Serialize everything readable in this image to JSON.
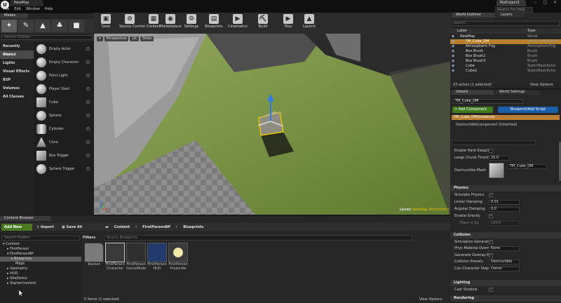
{
  "app": {
    "logo": "U",
    "doc_tab": "NewMap",
    "project_tab": "MyProject3",
    "search_help": "Search For Help",
    "menu": [
      "File",
      "Edit",
      "Window",
      "Help"
    ],
    "win": {
      "min": "–",
      "max": "□",
      "close": "✕"
    }
  },
  "modes": {
    "tab": "Modes",
    "icons": [
      {
        "name": "place-mode-icon",
        "glyph": "✦"
      },
      {
        "name": "paint-mode-icon",
        "glyph": "✎"
      },
      {
        "name": "landscape-mode-icon",
        "glyph": "▲"
      },
      {
        "name": "foliage-mode-icon",
        "glyph": "♣"
      },
      {
        "name": "geometry-mode-icon",
        "glyph": "■"
      }
    ],
    "search_placeholder": "Search Classes",
    "categories": [
      "Recently Placed",
      "Basic",
      "Lights",
      "Visual Effects",
      "BSP",
      "Volumes",
      "All Classes"
    ],
    "items": [
      {
        "label": "Empty Actor",
        "shape": "sphere"
      },
      {
        "label": "Empty Character",
        "shape": "sphere"
      },
      {
        "label": "Point Light",
        "shape": "sphere"
      },
      {
        "label": "Player Start",
        "shape": "sphere"
      },
      {
        "label": "Cube",
        "shape": "box"
      },
      {
        "label": "Sphere",
        "shape": "sphere"
      },
      {
        "label": "Cylinder",
        "shape": "cyl"
      },
      {
        "label": "Cone",
        "shape": "cone"
      },
      {
        "label": "Box Trigger",
        "shape": "box"
      },
      {
        "label": "Sphere Trigger",
        "shape": "sphere"
      }
    ]
  },
  "toolbar": {
    "buttons": [
      {
        "label": "Save",
        "icon": "save-icon",
        "glyph": "▣"
      },
      {
        "label": "Source Control",
        "icon": "source-control-icon",
        "glyph": "⊘"
      },
      {
        "label": "Content",
        "icon": "content-icon",
        "glyph": "▦"
      },
      {
        "label": "Marketplace",
        "icon": "marketplace-icon",
        "glyph": "◉"
      },
      {
        "label": "Settings",
        "icon": "settings-icon",
        "glyph": "⚙"
      },
      {
        "label": "Blueprints",
        "icon": "blueprints-icon",
        "glyph": "▤"
      },
      {
        "label": "Cinematics",
        "icon": "cinematics-icon",
        "glyph": "▶"
      },
      {
        "label": "Build",
        "icon": "build-icon",
        "glyph": "⛏"
      },
      {
        "label": "Play",
        "icon": "play-icon",
        "glyph": "▶"
      },
      {
        "label": "Launch",
        "icon": "launch-icon",
        "glyph": "▲"
      }
    ]
  },
  "viewport": {
    "perspective": "Perspective",
    "lit": "Lit",
    "show": "Show",
    "level_label": "Level:",
    "level_name": "NewMap (Persistent)"
  },
  "content_browser": {
    "tab": "Content Browser",
    "add_new": "Add New",
    "import": "Import",
    "save_all": "Save All",
    "crumbs": [
      "Content",
      "FirstPersonBP",
      "Blueprints"
    ],
    "search_folders": "Search Folders",
    "tree": [
      {
        "label": "▾ Content",
        "indent": 4
      },
      {
        "label": "▸ FirstPerson",
        "indent": 10
      },
      {
        "label": "▾ FirstPersonBP",
        "indent": 10
      },
      {
        "label": "▸ Blueprints",
        "indent": 16
      },
      {
        "label": "Maps",
        "indent": 22
      },
      {
        "label": "▸ Geometry",
        "indent": 10
      },
      {
        "label": "▸ HUD",
        "indent": 10
      },
      {
        "label": "▸ SiteDemo",
        "indent": 10
      },
      {
        "label": "▸ StarterContent",
        "indent": 10
      }
    ],
    "selected_tree_index": 3,
    "filters": "Filters",
    "search_placeholder": "Search Blueprints",
    "assets": [
      {
        "label": "Rocket",
        "kind": "folder"
      },
      {
        "label": "FirstPerson Character",
        "kind": "char"
      },
      {
        "label": "FirstPerson GameMode",
        "kind": "game"
      },
      {
        "label": "FirstPerson HUD",
        "kind": "hud"
      },
      {
        "label": "FirstPerson Projectile",
        "kind": "proj"
      }
    ],
    "selected_asset_index": 1,
    "status": "5 items (1 selected)",
    "view_options": "View Options"
  },
  "world_outliner": {
    "tab": "World Outliner",
    "tab2": "Layers",
    "search_placeholder": "Search...",
    "col_label": "Label",
    "col_type": "Type",
    "rows": [
      {
        "label": "NewMap",
        "type": "World"
      },
      {
        "label": "TM_Cube_DM",
        "type": "DestructibleActor"
      },
      {
        "label": "Atmospheric Fog",
        "type": "AtmosphericFog"
      },
      {
        "label": "Box Brush",
        "type": "Brush"
      },
      {
        "label": "Box Brush2",
        "type": "Brush"
      },
      {
        "label": "Box Brush3",
        "type": "Brush"
      },
      {
        "label": "Cube",
        "type": "StaticMeshActor"
      },
      {
        "label": "Cube2",
        "type": "StaticMeshActor"
      }
    ],
    "selected_index": 1,
    "actors": "23 actors (1 selected)",
    "view_options": "View Options"
  },
  "details": {
    "tab": "Details",
    "tab2": "World Settings",
    "name": "TM_Cube_DM",
    "add_component": "+ Add Component",
    "blueprint_btn": "Blueprint/Add Script",
    "component_sel": "TM_Cube_DM(Instance)",
    "component_child": "DestructibleComponent (Inherited)",
    "enable_hard_sleeping": "Enable Hard Sleeping",
    "large_chunk": "Large Chunk Threshol",
    "large_chunk_val": "25.0",
    "destructible_mesh": "Destructible Mesh",
    "mesh_val": "TM_Cube_DM",
    "physics": "Physics",
    "simulate": "Simulate Physics",
    "linear": "Linear Damping",
    "linear_val": "0.01",
    "angular": "Angular Damping",
    "angular_val": "0.0",
    "gravity": "Enable Gravity",
    "mass": "Mass in Kg",
    "mass_val": "100.0",
    "collision": "Collision",
    "sim_gen": "Simulation Generates",
    "phys_mat": "Phys Material Overri",
    "phys_mat_val": "None",
    "overlap": "Generate Overlap Eve",
    "presets": "Collision Presets",
    "presets_val": "Destructible",
    "step_up": "Can Character Step Up",
    "step_up_val": "Owner",
    "lighting": "Lighting",
    "cast_shadow": "Cast Shadow",
    "rendering": "Rendering"
  },
  "colors": {
    "accent_orange": "#b67f2a",
    "add_green": "#4a7a1f",
    "blueprint_blue": "#1b5ea8"
  }
}
